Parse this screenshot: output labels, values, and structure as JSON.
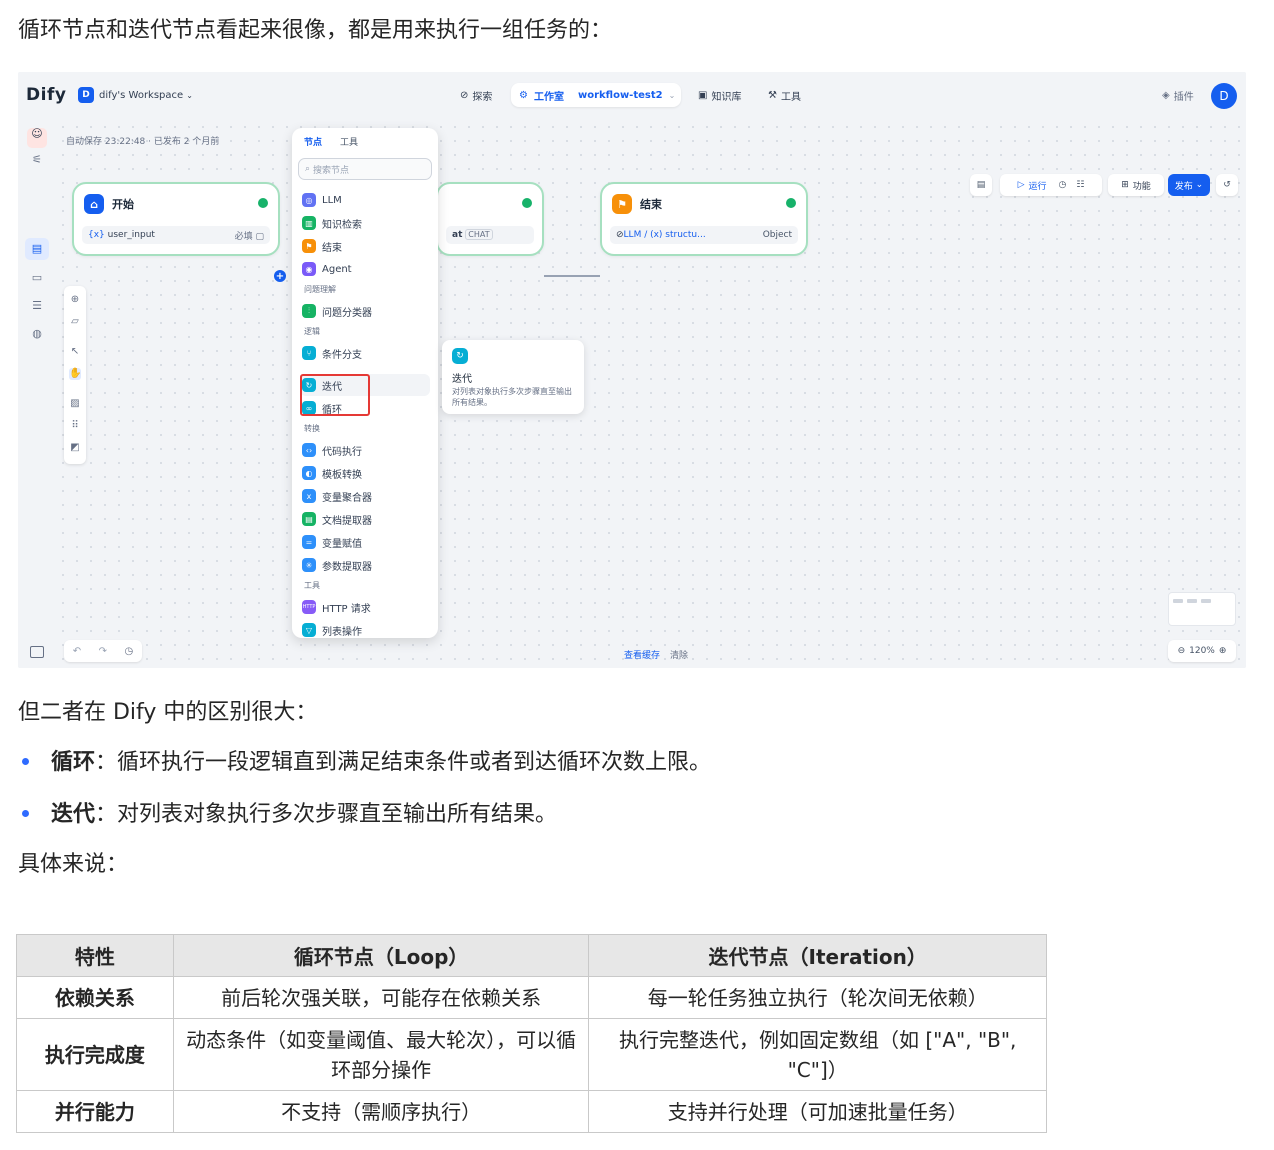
{
  "intro": "循环节点和迭代节点看起来很像，都是用来执行一组任务的：",
  "screenshot": {
    "logo_text": "Dify",
    "workspace_badge": "D",
    "workspace_name": "dify's Workspace",
    "nav": {
      "explore": "探索",
      "studio": "工作室",
      "workflow_name": "workflow-test2",
      "knowledge": "知识库",
      "tools": "工具",
      "plugins": "插件",
      "avatar": "D"
    },
    "autosave": "自动保存 23:22:48 · 已发布 2 个月前",
    "toolbar": {
      "run": "运行",
      "features": "功能",
      "publish": "发布"
    },
    "nodes": {
      "start": {
        "title": "开始",
        "var": "user_input",
        "required": "必填"
      },
      "middle": {
        "var_suffix": "at",
        "tag": "CHAT"
      },
      "end": {
        "title": "结束",
        "var": "LLM / (x) structu...",
        "type": "Object"
      }
    },
    "menu": {
      "tabs": [
        "节点",
        "工具"
      ],
      "search_placeholder": "搜索节点",
      "items": {
        "llm": "LLM",
        "knowledge": "知识检索",
        "end": "结束",
        "agent": "Agent",
        "grp_understand": "问题理解",
        "classifier": "问题分类器",
        "grp_logic": "逻辑",
        "ifelse": "条件分支",
        "iteration": "迭代",
        "loop": "循环",
        "grp_transform": "转换",
        "code": "代码执行",
        "template": "模板转换",
        "aggregator": "变量聚合器",
        "doc_extract": "文档提取器",
        "assign": "变量赋值",
        "param_extract": "参数提取器",
        "grp_tools": "工具",
        "http": "HTTP 请求",
        "list_op": "列表操作"
      }
    },
    "tooltip": {
      "title": "迭代",
      "desc": "对列表对象执行多次步骤直至输出所有结果。"
    },
    "bottom": {
      "view_cache": "查看缓存",
      "clear": "清除",
      "zoom": "120%"
    },
    "colors": {
      "accent": "#155eef",
      "success": "#17b26a",
      "highlight_box": "#e53935"
    }
  },
  "diff_intro": "但二者在 Dify 中的区别很大：",
  "bullets": [
    {
      "term": "循环",
      "text": "：循环执行一段逻辑直到满足结束条件或者到达循环次数上限。"
    },
    {
      "term": "迭代",
      "text": "：对列表对象执行多次步骤直至输出所有结果。"
    }
  ],
  "specifically": "具体来说：",
  "table": {
    "headers": [
      "特性",
      "循环节点（Loop）",
      "迭代节点（Iteration）"
    ],
    "rows": [
      [
        "依赖关系",
        "前后轮次强关联，可能存在依赖关系",
        "每一轮任务独立执行（轮次间无依赖）"
      ],
      [
        "执行完成度",
        "动态条件（如变量阈值、最大轮次），可以循环部分操作",
        "执行完整迭代，例如固定数组（如 [\"A\", \"B\", \"C\"]）"
      ],
      [
        "并行能力",
        "不支持（需顺序执行）",
        "支持并行处理（可加速批量任务）"
      ]
    ]
  }
}
